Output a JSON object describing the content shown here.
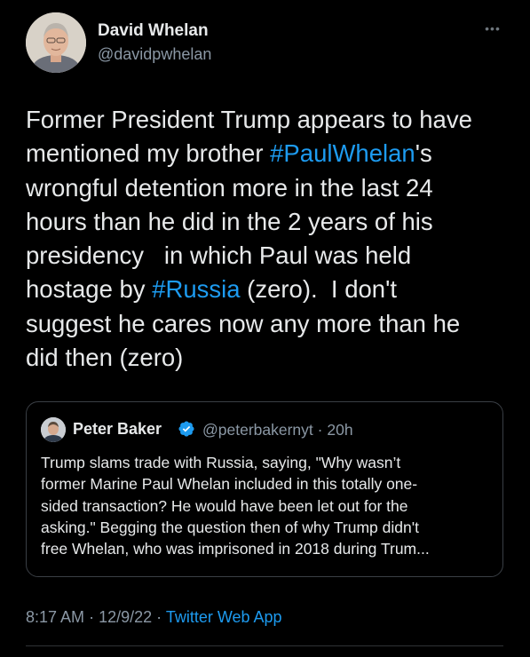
{
  "author": {
    "name": "David Whelan",
    "handle": "@davidpwhelan"
  },
  "more_icon": "more-horizontal-icon",
  "tweet": {
    "lines": [
      [
        "Former President Trump appears to have"
      ],
      [
        "mentioned my brother ",
        {
          "hashtag": "#PaulWhelan"
        },
        "'s"
      ],
      [
        "wrongful detention more in the last 24"
      ],
      [
        "hours than he did in the 2 years of his"
      ],
      [
        "presidency   in which Paul was held"
      ],
      [
        "hostage by ",
        {
          "hashtag": "#Russia"
        },
        " (zero).  I don't"
      ],
      [
        "suggest he cares now any more than he"
      ],
      [
        "did then (zero)"
      ]
    ]
  },
  "quoted": {
    "name": "Peter Baker",
    "verified_icon": "verified-badge-icon",
    "handle": "@peterbakernyt",
    "separator": "·",
    "age": "20h",
    "lines": [
      "Trump slams trade with Russia, saying, \"Why wasn’t",
      "former Marine Paul Whelan included in this totally one-",
      "sided transaction? He would have been let out for the",
      "asking.\" Begging the question then of why Trump didn't",
      "free Whelan, who was imprisoned in 2018 during Trum..."
    ]
  },
  "footer": {
    "time": "8:17 AM",
    "sep1": "·",
    "date": "12/9/22",
    "sep2": "·",
    "app": "Twitter Web App"
  },
  "colors": {
    "background": "#000000",
    "text": "#e7e9ea",
    "secondary": "#8b98a5",
    "link": "#1d9bf0",
    "verified": "#1d9bf0",
    "border": "#3a3f45"
  }
}
